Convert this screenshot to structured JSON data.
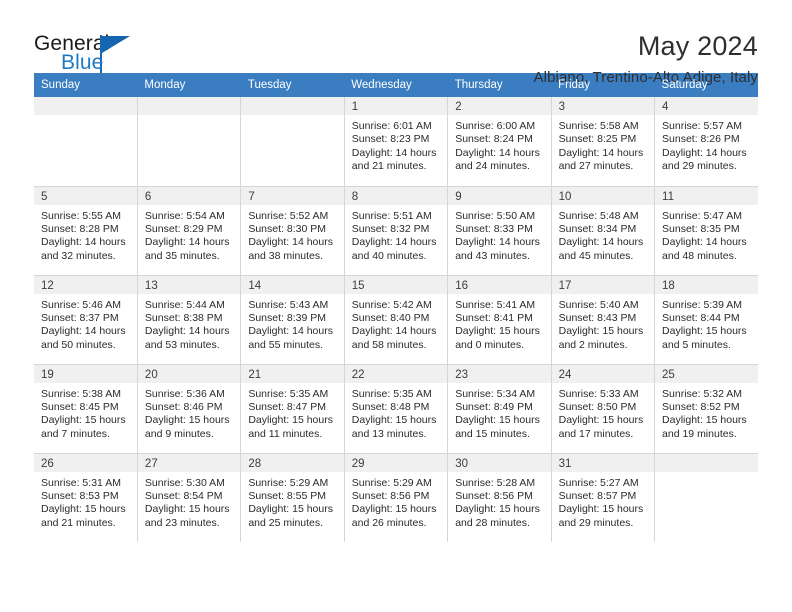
{
  "brand": {
    "name_part1": "General",
    "name_part2": "Blue",
    "logo_icon": "triangle-flag-icon",
    "accent_color": "#1565b0",
    "blue_text_color": "#1f7ac4"
  },
  "header": {
    "title": "May 2024",
    "subtitle": "Albiano, Trentino-Alto Adige, Italy"
  },
  "calendar": {
    "header_bg": "#3a7dc0",
    "daynum_bg": "#f0f0f0",
    "grid_color": "#d6d6d6",
    "weekday_headers": [
      "Sunday",
      "Monday",
      "Tuesday",
      "Wednesday",
      "Thursday",
      "Friday",
      "Saturday"
    ],
    "weeks": [
      [
        {
          "day": "",
          "empty": true,
          "sunrise": "",
          "sunset": "",
          "daylight1": "",
          "daylight2": ""
        },
        {
          "day": "",
          "empty": true,
          "sunrise": "",
          "sunset": "",
          "daylight1": "",
          "daylight2": ""
        },
        {
          "day": "",
          "empty": true,
          "sunrise": "",
          "sunset": "",
          "daylight1": "",
          "daylight2": ""
        },
        {
          "day": "1",
          "empty": false,
          "sunrise": "Sunrise: 6:01 AM",
          "sunset": "Sunset: 8:23 PM",
          "daylight1": "Daylight: 14 hours",
          "daylight2": "and 21 minutes."
        },
        {
          "day": "2",
          "empty": false,
          "sunrise": "Sunrise: 6:00 AM",
          "sunset": "Sunset: 8:24 PM",
          "daylight1": "Daylight: 14 hours",
          "daylight2": "and 24 minutes."
        },
        {
          "day": "3",
          "empty": false,
          "sunrise": "Sunrise: 5:58 AM",
          "sunset": "Sunset: 8:25 PM",
          "daylight1": "Daylight: 14 hours",
          "daylight2": "and 27 minutes."
        },
        {
          "day": "4",
          "empty": false,
          "sunrise": "Sunrise: 5:57 AM",
          "sunset": "Sunset: 8:26 PM",
          "daylight1": "Daylight: 14 hours",
          "daylight2": "and 29 minutes."
        }
      ],
      [
        {
          "day": "5",
          "empty": false,
          "sunrise": "Sunrise: 5:55 AM",
          "sunset": "Sunset: 8:28 PM",
          "daylight1": "Daylight: 14 hours",
          "daylight2": "and 32 minutes."
        },
        {
          "day": "6",
          "empty": false,
          "sunrise": "Sunrise: 5:54 AM",
          "sunset": "Sunset: 8:29 PM",
          "daylight1": "Daylight: 14 hours",
          "daylight2": "and 35 minutes."
        },
        {
          "day": "7",
          "empty": false,
          "sunrise": "Sunrise: 5:52 AM",
          "sunset": "Sunset: 8:30 PM",
          "daylight1": "Daylight: 14 hours",
          "daylight2": "and 38 minutes."
        },
        {
          "day": "8",
          "empty": false,
          "sunrise": "Sunrise: 5:51 AM",
          "sunset": "Sunset: 8:32 PM",
          "daylight1": "Daylight: 14 hours",
          "daylight2": "and 40 minutes."
        },
        {
          "day": "9",
          "empty": false,
          "sunrise": "Sunrise: 5:50 AM",
          "sunset": "Sunset: 8:33 PM",
          "daylight1": "Daylight: 14 hours",
          "daylight2": "and 43 minutes."
        },
        {
          "day": "10",
          "empty": false,
          "sunrise": "Sunrise: 5:48 AM",
          "sunset": "Sunset: 8:34 PM",
          "daylight1": "Daylight: 14 hours",
          "daylight2": "and 45 minutes."
        },
        {
          "day": "11",
          "empty": false,
          "sunrise": "Sunrise: 5:47 AM",
          "sunset": "Sunset: 8:35 PM",
          "daylight1": "Daylight: 14 hours",
          "daylight2": "and 48 minutes."
        }
      ],
      [
        {
          "day": "12",
          "empty": false,
          "sunrise": "Sunrise: 5:46 AM",
          "sunset": "Sunset: 8:37 PM",
          "daylight1": "Daylight: 14 hours",
          "daylight2": "and 50 minutes."
        },
        {
          "day": "13",
          "empty": false,
          "sunrise": "Sunrise: 5:44 AM",
          "sunset": "Sunset: 8:38 PM",
          "daylight1": "Daylight: 14 hours",
          "daylight2": "and 53 minutes."
        },
        {
          "day": "14",
          "empty": false,
          "sunrise": "Sunrise: 5:43 AM",
          "sunset": "Sunset: 8:39 PM",
          "daylight1": "Daylight: 14 hours",
          "daylight2": "and 55 minutes."
        },
        {
          "day": "15",
          "empty": false,
          "sunrise": "Sunrise: 5:42 AM",
          "sunset": "Sunset: 8:40 PM",
          "daylight1": "Daylight: 14 hours",
          "daylight2": "and 58 minutes."
        },
        {
          "day": "16",
          "empty": false,
          "sunrise": "Sunrise: 5:41 AM",
          "sunset": "Sunset: 8:41 PM",
          "daylight1": "Daylight: 15 hours",
          "daylight2": "and 0 minutes."
        },
        {
          "day": "17",
          "empty": false,
          "sunrise": "Sunrise: 5:40 AM",
          "sunset": "Sunset: 8:43 PM",
          "daylight1": "Daylight: 15 hours",
          "daylight2": "and 2 minutes."
        },
        {
          "day": "18",
          "empty": false,
          "sunrise": "Sunrise: 5:39 AM",
          "sunset": "Sunset: 8:44 PM",
          "daylight1": "Daylight: 15 hours",
          "daylight2": "and 5 minutes."
        }
      ],
      [
        {
          "day": "19",
          "empty": false,
          "sunrise": "Sunrise: 5:38 AM",
          "sunset": "Sunset: 8:45 PM",
          "daylight1": "Daylight: 15 hours",
          "daylight2": "and 7 minutes."
        },
        {
          "day": "20",
          "empty": false,
          "sunrise": "Sunrise: 5:36 AM",
          "sunset": "Sunset: 8:46 PM",
          "daylight1": "Daylight: 15 hours",
          "daylight2": "and 9 minutes."
        },
        {
          "day": "21",
          "empty": false,
          "sunrise": "Sunrise: 5:35 AM",
          "sunset": "Sunset: 8:47 PM",
          "daylight1": "Daylight: 15 hours",
          "daylight2": "and 11 minutes."
        },
        {
          "day": "22",
          "empty": false,
          "sunrise": "Sunrise: 5:35 AM",
          "sunset": "Sunset: 8:48 PM",
          "daylight1": "Daylight: 15 hours",
          "daylight2": "and 13 minutes."
        },
        {
          "day": "23",
          "empty": false,
          "sunrise": "Sunrise: 5:34 AM",
          "sunset": "Sunset: 8:49 PM",
          "daylight1": "Daylight: 15 hours",
          "daylight2": "and 15 minutes."
        },
        {
          "day": "24",
          "empty": false,
          "sunrise": "Sunrise: 5:33 AM",
          "sunset": "Sunset: 8:50 PM",
          "daylight1": "Daylight: 15 hours",
          "daylight2": "and 17 minutes."
        },
        {
          "day": "25",
          "empty": false,
          "sunrise": "Sunrise: 5:32 AM",
          "sunset": "Sunset: 8:52 PM",
          "daylight1": "Daylight: 15 hours",
          "daylight2": "and 19 minutes."
        }
      ],
      [
        {
          "day": "26",
          "empty": false,
          "sunrise": "Sunrise: 5:31 AM",
          "sunset": "Sunset: 8:53 PM",
          "daylight1": "Daylight: 15 hours",
          "daylight2": "and 21 minutes."
        },
        {
          "day": "27",
          "empty": false,
          "sunrise": "Sunrise: 5:30 AM",
          "sunset": "Sunset: 8:54 PM",
          "daylight1": "Daylight: 15 hours",
          "daylight2": "and 23 minutes."
        },
        {
          "day": "28",
          "empty": false,
          "sunrise": "Sunrise: 5:29 AM",
          "sunset": "Sunset: 8:55 PM",
          "daylight1": "Daylight: 15 hours",
          "daylight2": "and 25 minutes."
        },
        {
          "day": "29",
          "empty": false,
          "sunrise": "Sunrise: 5:29 AM",
          "sunset": "Sunset: 8:56 PM",
          "daylight1": "Daylight: 15 hours",
          "daylight2": "and 26 minutes."
        },
        {
          "day": "30",
          "empty": false,
          "sunrise": "Sunrise: 5:28 AM",
          "sunset": "Sunset: 8:56 PM",
          "daylight1": "Daylight: 15 hours",
          "daylight2": "and 28 minutes."
        },
        {
          "day": "31",
          "empty": false,
          "sunrise": "Sunrise: 5:27 AM",
          "sunset": "Sunset: 8:57 PM",
          "daylight1": "Daylight: 15 hours",
          "daylight2": "and 29 minutes."
        },
        {
          "day": "",
          "empty": true,
          "sunrise": "",
          "sunset": "",
          "daylight1": "",
          "daylight2": ""
        }
      ]
    ]
  }
}
